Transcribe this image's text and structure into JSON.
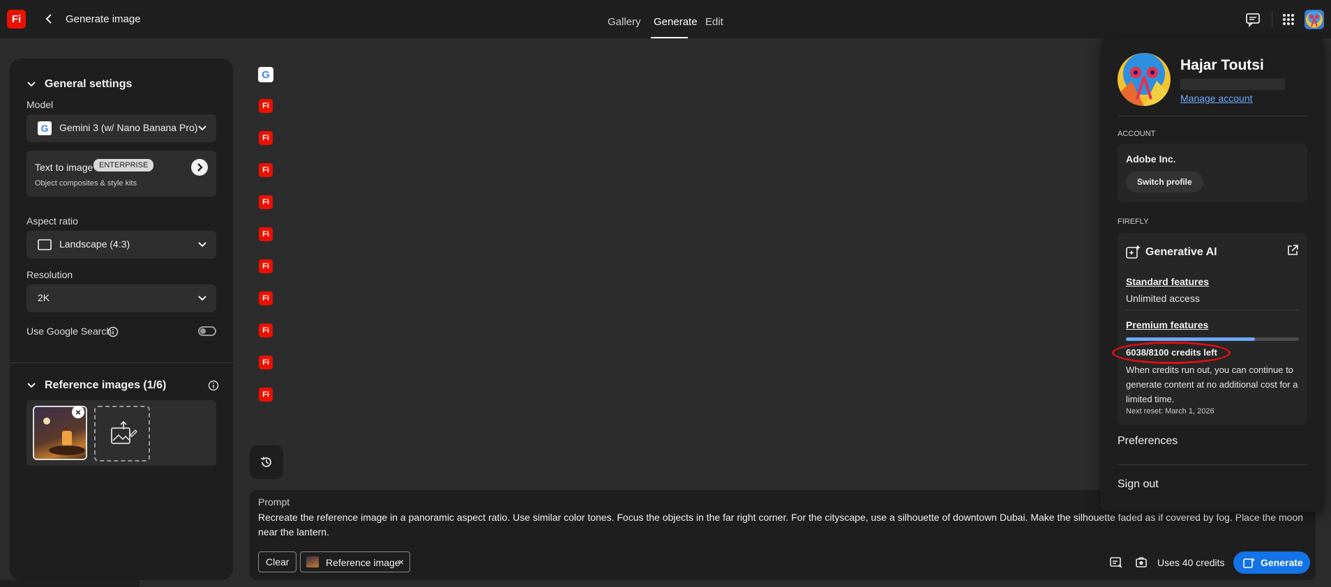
{
  "header": {
    "logo_text": "Fi",
    "page_title": "Generate image",
    "tabs": [
      {
        "label": "Gallery"
      },
      {
        "label": "Generate",
        "active": true
      },
      {
        "label": "Edit"
      }
    ]
  },
  "left_panel": {
    "general_settings_title": "General settings",
    "model_label": "Model",
    "model_value": "Gemini 3 (w/ Nano Banana Pro)",
    "mode_title": "Text to image",
    "mode_badge": "ENTERPRISE",
    "mode_subtitle": "Object composites & style kits",
    "aspect_label": "Aspect ratio",
    "aspect_value": "Landscape (4:3)",
    "resolution_label": "Resolution",
    "resolution_value": "2K",
    "google_search_label": "Use Google Search",
    "google_search_enabled": false,
    "reference_title": "Reference images (1/6)"
  },
  "history_icons": {
    "google_icon": "G",
    "firefly_icon_text": "Fi"
  },
  "prompt": {
    "label": "Prompt",
    "text": " Recreate the reference image in a panoramic aspect ratio. Use similar color tones. Focus the objects in the far right corner. For the cityscape, use a silhouette of downtown Dubai. Make the silhouette faded as if covered by fog. Place the moon near the lantern.",
    "clear_label": "Clear",
    "reference_chip_label": "Reference image",
    "chip_close": "×",
    "credits_cost": "Uses 40 credits",
    "generate_label": "Generate"
  },
  "account_menu": {
    "user_name": "Hajar Toutsi",
    "manage_account": "Manage account",
    "account_section": "ACCOUNT",
    "org_name": "Adobe Inc.",
    "switch_profile": "Switch profile",
    "firefly_section": "FIREFLY",
    "genai_title": "Generative AI",
    "standard_features": "Standard features",
    "standard_access": "Unlimited access",
    "premium_features": "Premium features",
    "credits_used_fraction": 0.7457,
    "credits_left": "6038/8100 credits left",
    "credits_info": "When credits run out, you can continue to generate content at no additional cost for a limited time.",
    "next_reset": "Next reset: March 1, 2026",
    "preferences": "Preferences",
    "sign_out": "Sign out"
  },
  "colors": {
    "brand_red": "#eb1000",
    "accent_blue": "#1473e6",
    "link_blue": "#6ea8fe",
    "annotation_red": "#e01010"
  }
}
